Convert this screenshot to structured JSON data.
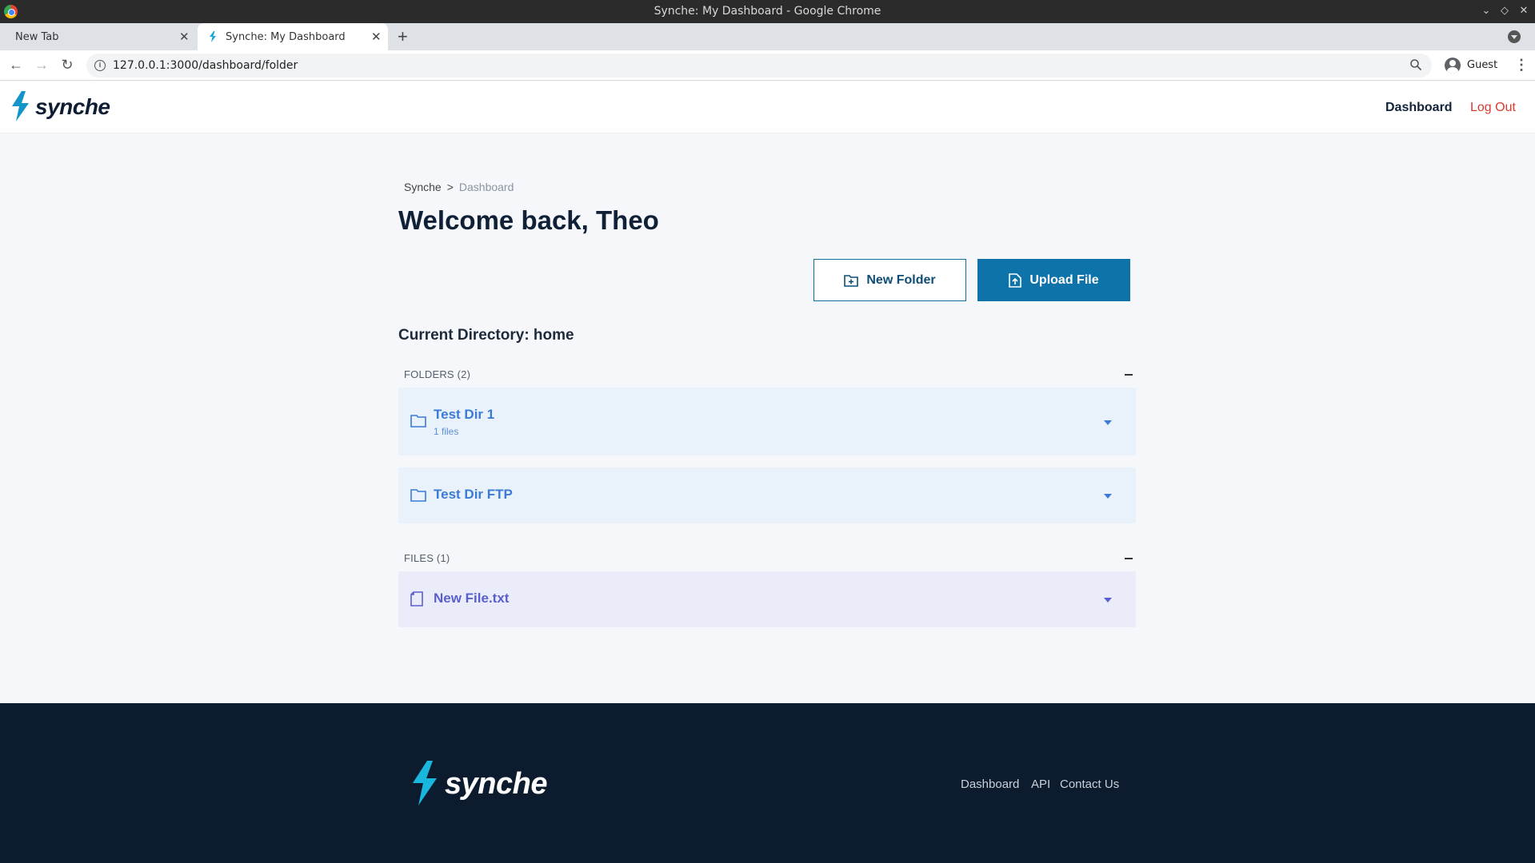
{
  "window": {
    "title": "Synche: My Dashboard - Google Chrome"
  },
  "tabs": [
    {
      "label": "New Tab",
      "active": false
    },
    {
      "label": "Synche: My Dashboard",
      "active": true
    }
  ],
  "address_bar": {
    "url": "127.0.0.1:3000/dashboard/folder"
  },
  "profile": {
    "name": "Guest"
  },
  "header": {
    "brand": "synche",
    "nav": {
      "dashboard": "Dashboard",
      "logout": "Log Out"
    }
  },
  "breadcrumb": {
    "root": "Synche",
    "separator": ">",
    "current": "Dashboard"
  },
  "page": {
    "welcome": "Welcome back, Theo",
    "new_folder_label": "New Folder",
    "upload_file_label": "Upload File",
    "current_directory": "Current Directory: home"
  },
  "folders": {
    "heading": "FOLDERS (2)",
    "items": [
      {
        "name": "Test Dir 1",
        "sub": "1 files"
      },
      {
        "name": "Test Dir FTP",
        "sub": ""
      }
    ]
  },
  "files": {
    "heading": "FILES (1)",
    "items": [
      {
        "name": "New File.txt"
      }
    ]
  },
  "footer": {
    "brand": "synche",
    "links": {
      "dashboard": "Dashboard",
      "api": "API",
      "contact": "Contact Us"
    }
  },
  "colors": {
    "primary": "#0e73a8",
    "logout": "#d93a30",
    "footer_bg": "#0d1b2e",
    "folder_row_bg": "#e9f2fb",
    "file_row_bg": "#eaedf9"
  }
}
